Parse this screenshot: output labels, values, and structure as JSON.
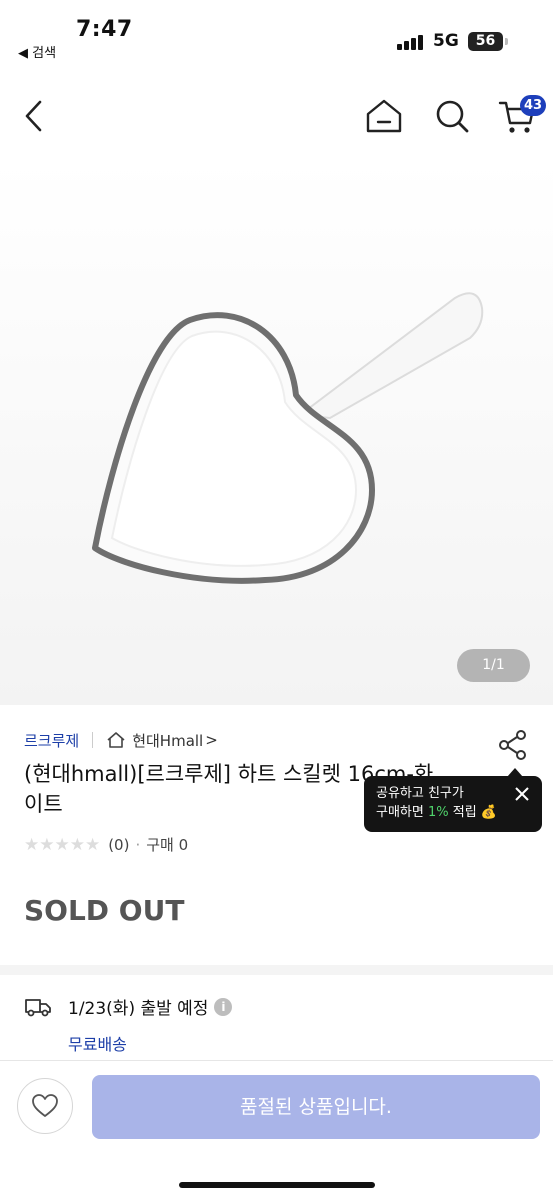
{
  "status_bar": {
    "time": "7:47",
    "back_app": "◀ 검색",
    "network": "5G",
    "battery": "56"
  },
  "header": {
    "cart_count": "43",
    "icons": [
      "back-icon",
      "home-icon",
      "search-icon",
      "cart-icon"
    ]
  },
  "gallery": {
    "pager": "1/1"
  },
  "product": {
    "brand": "르크루제",
    "mall": "현대Hmall",
    "mall_chevron": ">",
    "title": "(현대hmall)[르크루제] 하트 스킬렛 16cm-화이트",
    "stars": "★★★★★",
    "review_count": "(0)",
    "dot": "·",
    "purchase_count": "구매 0",
    "status": "SOLD OUT"
  },
  "share_tooltip": {
    "line1": "공유하고 친구가",
    "line2_prefix": "구매하면 ",
    "line2_highlight": "1%",
    "line2_suffix": " 적립 💰"
  },
  "shipping": {
    "date": "1/23(화) 출발 예정",
    "info": "i",
    "free_shipping": "무료배송"
  },
  "bottom_bar": {
    "buy_label": "품절된 상품입니다."
  },
  "colors": {
    "accent": "#1d3fa8",
    "badge": "#1d3fbb",
    "disabled_button": "#a9b4e8",
    "highlight": "#4fd36b"
  }
}
